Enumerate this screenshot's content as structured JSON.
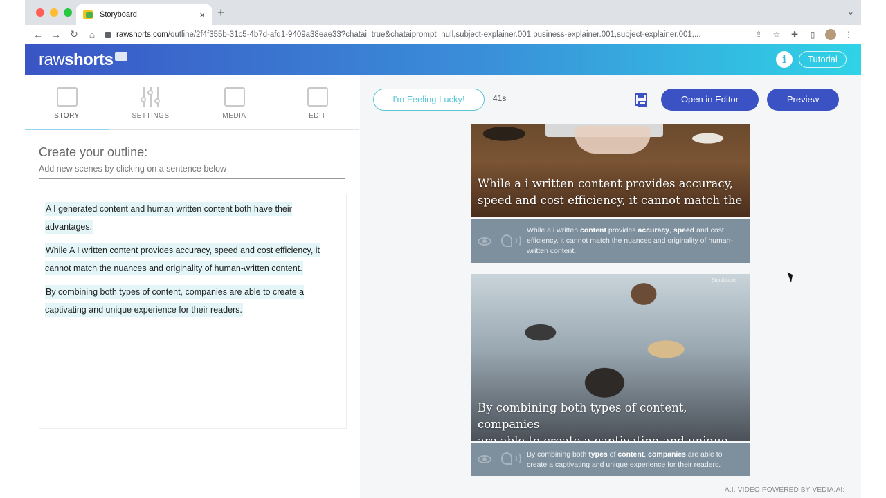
{
  "browser": {
    "tab_title": "Storyboard",
    "tab_close": "×",
    "new_tab": "+",
    "url_host": "rawshorts.com",
    "url_rest": "/outline/2f4f355b-31c5-4b7d-afd1-9409a38eae33?chatai=true&chataiprompt=null,subject-explainer.001,business-explainer.001,subject-explainer.001,...",
    "nav": {
      "back": "←",
      "forward": "→",
      "reload": "↻",
      "home": "⌂"
    },
    "tab_menu": "⌄",
    "traffic_lights": [
      "#ff5f57",
      "#febc2e",
      "#28c840"
    ]
  },
  "app": {
    "logo_light": "raw",
    "logo_bold": "shorts",
    "info_label": "i",
    "tutorial_label": "Tutorial",
    "header_gradient": [
      "#3a55c5",
      "#2fd3e6"
    ]
  },
  "left": {
    "tabs": [
      {
        "label": "STORY",
        "icon": "story-icon",
        "active": true
      },
      {
        "label": "SETTINGS",
        "icon": "settings-sliders-icon",
        "active": false
      },
      {
        "label": "MEDIA",
        "icon": "media-image-icon",
        "active": false
      },
      {
        "label": "EDIT",
        "icon": "edit-image-icon",
        "active": false
      }
    ],
    "outline_title": "Create your outline:",
    "outline_subtitle": "Add new scenes by clicking on a sentence below",
    "sentences": [
      "A I generated content and human written content both have their advantages.",
      "While A I written content provides accuracy, speed and cost efficiency, it cannot match the nuances and originality of human-written content.",
      "By combining both types of content, companies are able to create a captivating and unique experience for their readers."
    ]
  },
  "right": {
    "lucky_label": "I'm Feeling Lucky!",
    "duration": "41s",
    "open_editor_label": "Open in Editor",
    "preview_label": "Preview",
    "scenes": [
      {
        "caption_line1": "While a i written content provides accuracy,",
        "caption_line2": "speed and cost efficiency, it cannot match the",
        "bar_parts": [
          [
            "While a i written ",
            false
          ],
          [
            "content",
            true
          ],
          [
            " provides ",
            false
          ],
          [
            "accuracy",
            true
          ],
          [
            ", ",
            false
          ],
          [
            "speed",
            true
          ],
          [
            " and cost efficiency, it cannot match the nuances and originality of human-written content.",
            false
          ]
        ]
      },
      {
        "caption_line1": "By combining both types of content, companies",
        "caption_line2": "are able to create a captivating and unique",
        "watermark": "Storyblocks",
        "bar_parts": [
          [
            "By combining both ",
            false
          ],
          [
            "types",
            true
          ],
          [
            " of ",
            false
          ],
          [
            "content",
            true
          ],
          [
            ", ",
            false
          ],
          [
            "companies",
            true
          ],
          [
            " are able to create a captivating and unique experience for their readers.",
            false
          ]
        ]
      }
    ],
    "powered_by": "A.I. VIDEO POWERED BY VEDIA.AI:"
  },
  "colors": {
    "accent_blue": "#3b52c4",
    "lucky_teal": "#58c6d4",
    "sentence_highlight": "#e3f5f6",
    "scene_bar": "#7e909e"
  }
}
